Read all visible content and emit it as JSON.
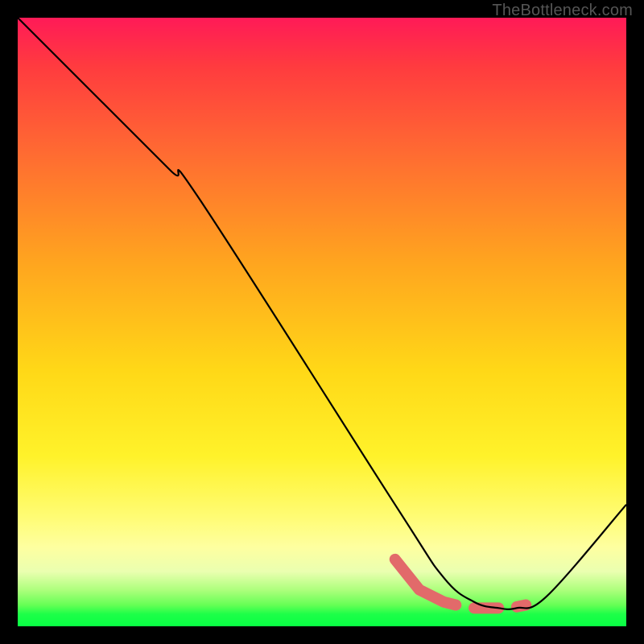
{
  "watermark": {
    "text": "TheBottleneck.com"
  },
  "chart_data": {
    "type": "line",
    "title": "",
    "xlabel": "",
    "ylabel": "",
    "xlim": [
      0,
      100
    ],
    "ylim": [
      0,
      100
    ],
    "series": [
      {
        "name": "curve",
        "x": [
          0,
          10,
          25,
          30,
          62,
          70,
          75,
          79,
          82,
          87,
          100
        ],
        "y": [
          100,
          90,
          75,
          70,
          20,
          8,
          4,
          3,
          3,
          5,
          20
        ]
      },
      {
        "name": "highlight-a",
        "x": [
          62,
          66,
          70,
          72
        ],
        "y": [
          11,
          6,
          4,
          3.5
        ]
      },
      {
        "name": "highlight-b",
        "x": [
          75,
          79
        ],
        "y": [
          3,
          3
        ]
      },
      {
        "name": "highlight-c",
        "x": [
          82,
          83.5
        ],
        "y": [
          3.2,
          3.5
        ]
      }
    ],
    "highlight_style": {
      "color": "#e26a6a",
      "width": 14,
      "cap": "round"
    },
    "line_style": {
      "color": "#000000",
      "width": 2.2
    }
  }
}
